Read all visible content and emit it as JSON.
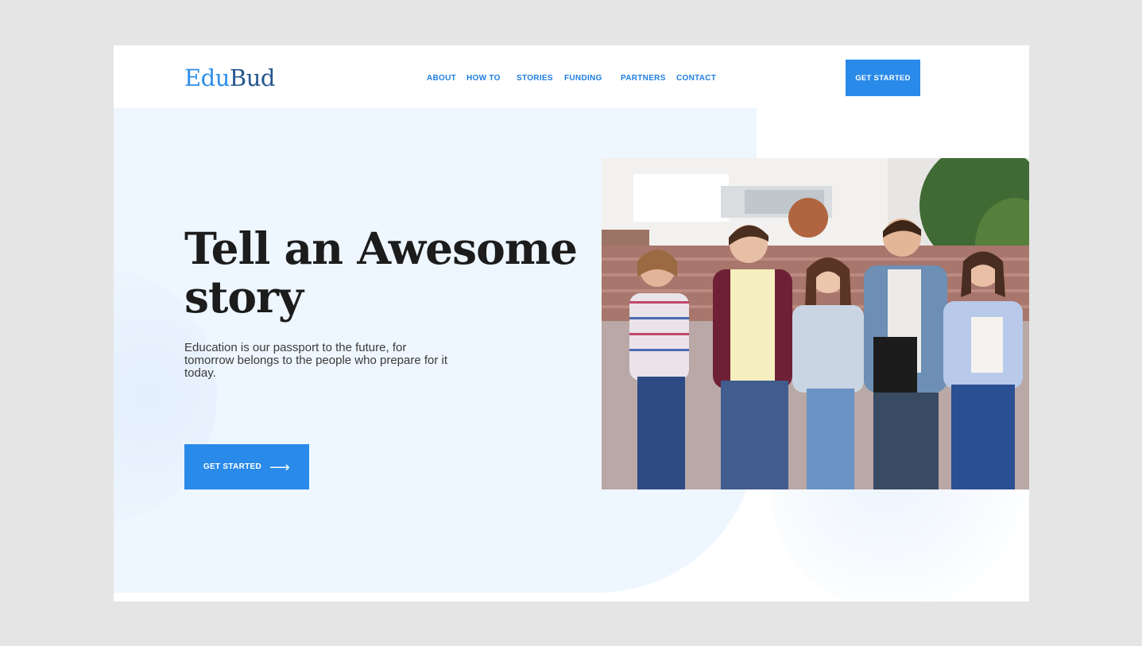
{
  "brand": {
    "logo_part1": "Edu",
    "logo_part2": "Bud"
  },
  "nav": {
    "items": [
      "ABOUT",
      "HOW TO",
      "STORIES",
      "FUNDING",
      "PARTNERS",
      "CONTACT"
    ]
  },
  "header": {
    "cta_label": "GET STARTED"
  },
  "hero": {
    "headline_line1": "Tell an Awesome",
    "headline_line2": "story",
    "subtext": "Education is our passport to the future, for tomorrow belongs to the people who prepare for it today.",
    "cta_label": "GET STARTED",
    "cta_icon": "arrow-right-icon"
  },
  "colors": {
    "accent": "#2a8ae9",
    "hero_bg": "#eef6ff",
    "logo_dark": "#24568e",
    "page_bg": "#e5e5e5"
  }
}
